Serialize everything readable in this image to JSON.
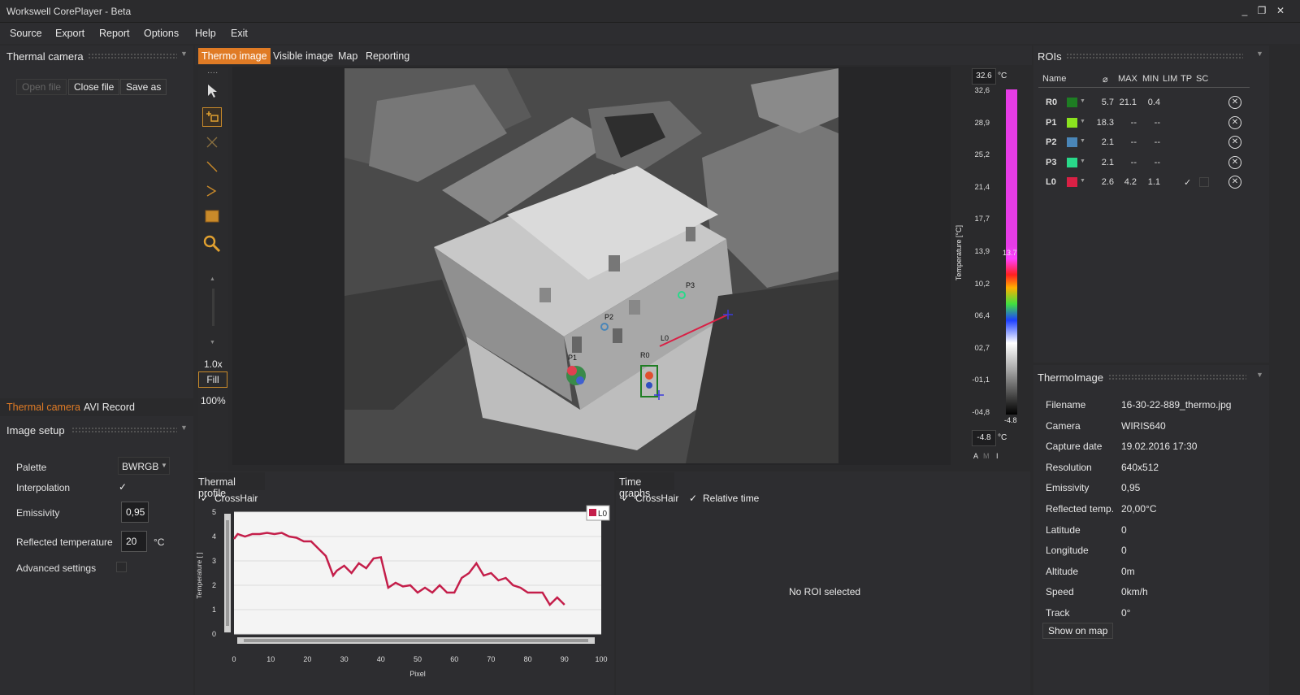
{
  "app": {
    "title": "Workswell CorePlayer - Beta"
  },
  "menu": [
    "Source",
    "Export",
    "Report",
    "Options",
    "Help",
    "Exit"
  ],
  "left": {
    "header": "Thermal camera",
    "open_file": "Open file",
    "close_file": "Close file",
    "save_as": "Save as",
    "tabs": [
      "Thermal camera",
      "AVI Record"
    ],
    "image_setup": "Image setup",
    "palette_label": "Palette",
    "palette_value": "BWRGB",
    "interpolation_label": "Interpolation",
    "interpolation_check": "✓",
    "emissivity_label": "Emissivity",
    "emissivity_value": "0,95",
    "refl_label": "Reflected temperature",
    "refl_value": "20",
    "refl_unit": "°C",
    "advanced_label": "Advanced settings"
  },
  "center": {
    "tabs": [
      "Thermo image",
      "Visible image",
      "Map",
      "Reporting"
    ],
    "zoom": "1.0x",
    "fill": "Fill",
    "percent": "100%",
    "markers": {
      "p3": "P3",
      "p2": "P2",
      "p1": "P1",
      "r0": "R0",
      "l0": "L0"
    }
  },
  "scale": {
    "max_value": "32.6",
    "min_value": "-4.8",
    "unit": "°C",
    "label": "Temperature [°C]",
    "ticks": [
      "32,6",
      "28,9",
      "25,2",
      "21,4",
      "17,7",
      "13,9",
      "10,2",
      "06,4",
      "02,7",
      "-01,1",
      "-04,8"
    ],
    "upper_mark": "13.7",
    "lower_mark": "-4.8",
    "abc": [
      "A",
      "M",
      "I"
    ]
  },
  "rois": {
    "header": "ROIs",
    "columns": [
      "Name",
      "⌀",
      "MAX",
      "MIN",
      "LIM",
      "TP",
      "SC"
    ],
    "rows": [
      {
        "name": "R0",
        "color": "#1e7d23",
        "avg": "5.7",
        "max": "21.1",
        "min": "0.4",
        "lim": "",
        "tp": ""
      },
      {
        "name": "P1",
        "color": "#8be31f",
        "avg": "18.3",
        "max": "--",
        "min": "--",
        "lim": "",
        "tp": ""
      },
      {
        "name": "P2",
        "color": "#4a86b8",
        "avg": "2.1",
        "max": "--",
        "min": "--",
        "lim": "",
        "tp": ""
      },
      {
        "name": "P3",
        "color": "#29d98a",
        "avg": "2.1",
        "max": "--",
        "min": "--",
        "lim": "",
        "tp": ""
      },
      {
        "name": "L0",
        "color": "#d92045",
        "avg": "2.6",
        "max": "4.2",
        "min": "1.1",
        "lim": "✓",
        "tp": ""
      }
    ]
  },
  "thermoimage": {
    "header": "ThermoImage",
    "fields": [
      {
        "k": "Filename",
        "v": "16-30-22-889_thermo.jpg"
      },
      {
        "k": "Camera",
        "v": "WIRIS640"
      },
      {
        "k": "Capture date",
        "v": "19.02.2016 17:30"
      },
      {
        "k": "Resolution",
        "v": "640x512"
      },
      {
        "k": "Emissivity",
        "v": "0,95"
      },
      {
        "k": "Reflected temp.",
        "v": "20,00°C"
      },
      {
        "k": "Latitude",
        "v": "0"
      },
      {
        "k": "Longitude",
        "v": "0"
      },
      {
        "k": "Altitude",
        "v": "0m"
      },
      {
        "k": "Speed",
        "v": "0km/h"
      },
      {
        "k": "Track",
        "v": "0°"
      }
    ],
    "show_on_map": "Show on map"
  },
  "profile": {
    "header": "Thermal profile",
    "crosshair": "CrossHair",
    "legend": "L0",
    "ylabel": "Temperature [ ]",
    "xlabel": "Pixel"
  },
  "timegraphs": {
    "header": "Time graphs",
    "crosshair": "CrossHair",
    "relative": "Relative time",
    "empty": "No ROI selected"
  },
  "chart_data": {
    "type": "line",
    "title": "",
    "xlabel": "Pixel",
    "ylabel": "Temperature [ ]",
    "xlim": [
      0,
      100
    ],
    "ylim": [
      0,
      5
    ],
    "xticks": [
      0,
      10,
      20,
      30,
      40,
      50,
      60,
      70,
      80,
      90,
      100
    ],
    "yticks": [
      0,
      1,
      2,
      3,
      4,
      5
    ],
    "series": [
      {
        "name": "L0",
        "color": "#c41e4a",
        "x": [
          0,
          1,
          3,
          5,
          7,
          9,
          11,
          13,
          15,
          17,
          19,
          21,
          23,
          25,
          27,
          28,
          30,
          32,
          34,
          36,
          38,
          40,
          42,
          44,
          46,
          48,
          50,
          52,
          54,
          56,
          58,
          60,
          62,
          64,
          66,
          68,
          70,
          72,
          74,
          76,
          78,
          80,
          82,
          84,
          86,
          88,
          90
        ],
        "values": [
          3.9,
          4.1,
          4.0,
          4.1,
          4.1,
          4.15,
          4.1,
          4.15,
          4.0,
          3.95,
          3.8,
          3.8,
          3.5,
          3.2,
          2.4,
          2.6,
          2.8,
          2.5,
          2.9,
          2.7,
          3.1,
          3.15,
          1.9,
          2.1,
          1.95,
          2.0,
          1.7,
          1.9,
          1.7,
          2.0,
          1.7,
          1.7,
          2.3,
          2.5,
          2.9,
          2.4,
          2.5,
          2.2,
          2.3,
          2.0,
          1.9,
          1.7,
          1.7,
          1.7,
          1.2,
          1.5,
          1.2
        ]
      }
    ],
    "grid": true,
    "legend": "top-right"
  }
}
